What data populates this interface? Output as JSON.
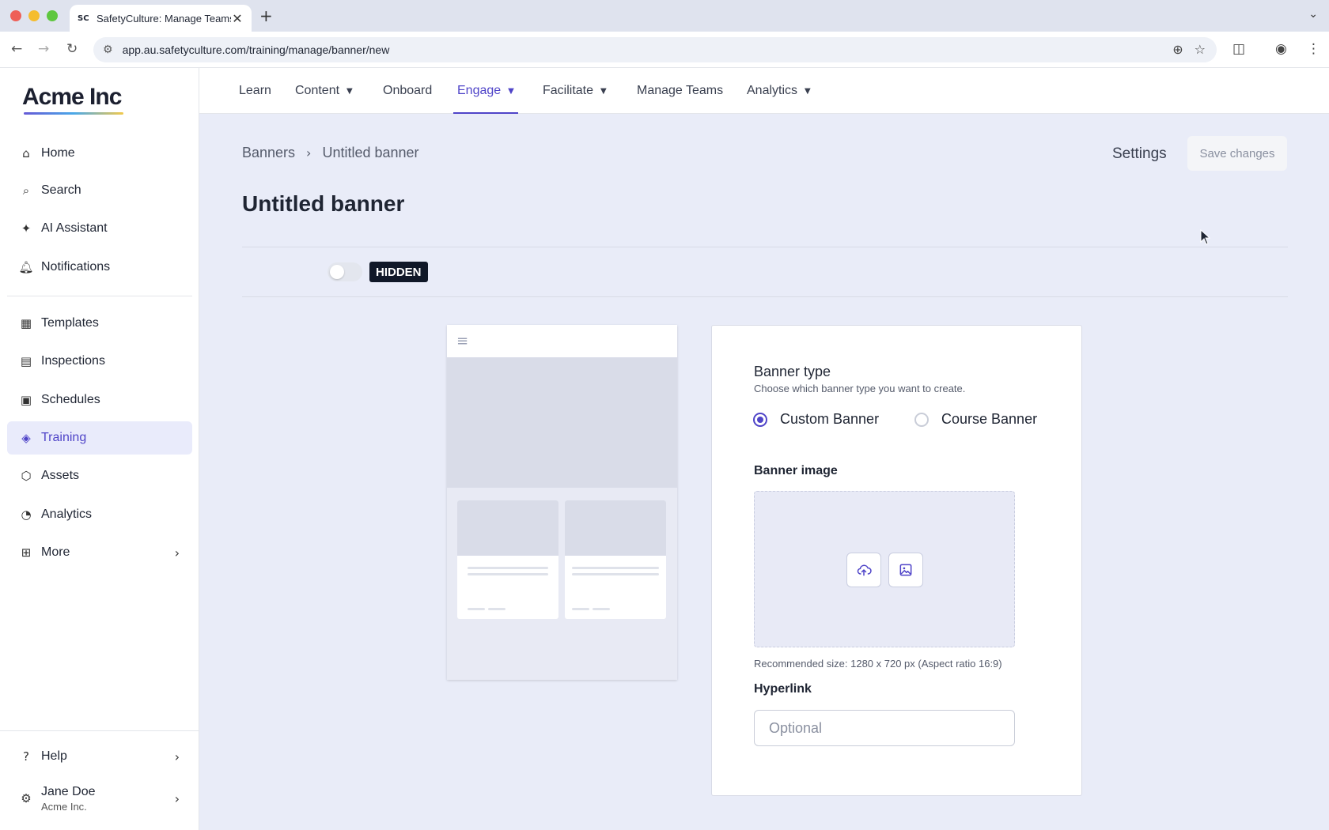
{
  "browser": {
    "tab_title": "SafetyCulture: Manage Teams",
    "tab_favicon": "SC",
    "url": "app.au.safetyculture.com/training/manage/banner/new"
  },
  "sidebar": {
    "logo": "Acme Inc",
    "items": [
      {
        "label": "Home",
        "icon": "home-icon"
      },
      {
        "label": "Search",
        "icon": "search-icon"
      },
      {
        "label": "AI Assistant",
        "icon": "sparkle-icon"
      },
      {
        "label": "Notifications",
        "icon": "bell-icon"
      },
      {
        "label": "Templates",
        "icon": "template-icon"
      },
      {
        "label": "Inspections",
        "icon": "clipboard-icon"
      },
      {
        "label": "Schedules",
        "icon": "calendar-icon"
      },
      {
        "label": "Training",
        "icon": "graduation-cap-icon"
      },
      {
        "label": "Assets",
        "icon": "cube-icon"
      },
      {
        "label": "Analytics",
        "icon": "pie-chart-icon"
      },
      {
        "label": "More",
        "icon": "grid-icon"
      }
    ],
    "help": "Help",
    "user": {
      "name": "Jane Doe",
      "org": "Acme Inc."
    }
  },
  "topnav": {
    "items": [
      {
        "label": "Learn"
      },
      {
        "label": "Content"
      },
      {
        "label": "Onboard"
      },
      {
        "label": "Engage"
      },
      {
        "label": "Facilitate"
      },
      {
        "label": "Manage Teams"
      },
      {
        "label": "Analytics"
      }
    ],
    "active": "Engage"
  },
  "breadcrumb": {
    "parent": "Banners",
    "current": "Untitled banner"
  },
  "header": {
    "settings": "Settings",
    "save": "Save changes"
  },
  "page_title": "Untitled banner",
  "visibility": {
    "badge": "HIDDEN"
  },
  "form": {
    "banner_type_label": "Banner type",
    "banner_type_help": "Choose which banner type you want to create.",
    "options": [
      "Custom Banner",
      "Course Banner"
    ],
    "selected": "Custom Banner",
    "banner_image_label": "Banner image",
    "recommended": "Recommended size: 1280 x 720 px (Aspect ratio 16:9)",
    "hyperlink_label": "Hyperlink",
    "hyperlink_placeholder": "Optional",
    "hyperlink_value": ""
  },
  "colors": {
    "accent": "#4f44c8",
    "badge_bg": "#101828",
    "page_bg": "#e9ecf8"
  }
}
